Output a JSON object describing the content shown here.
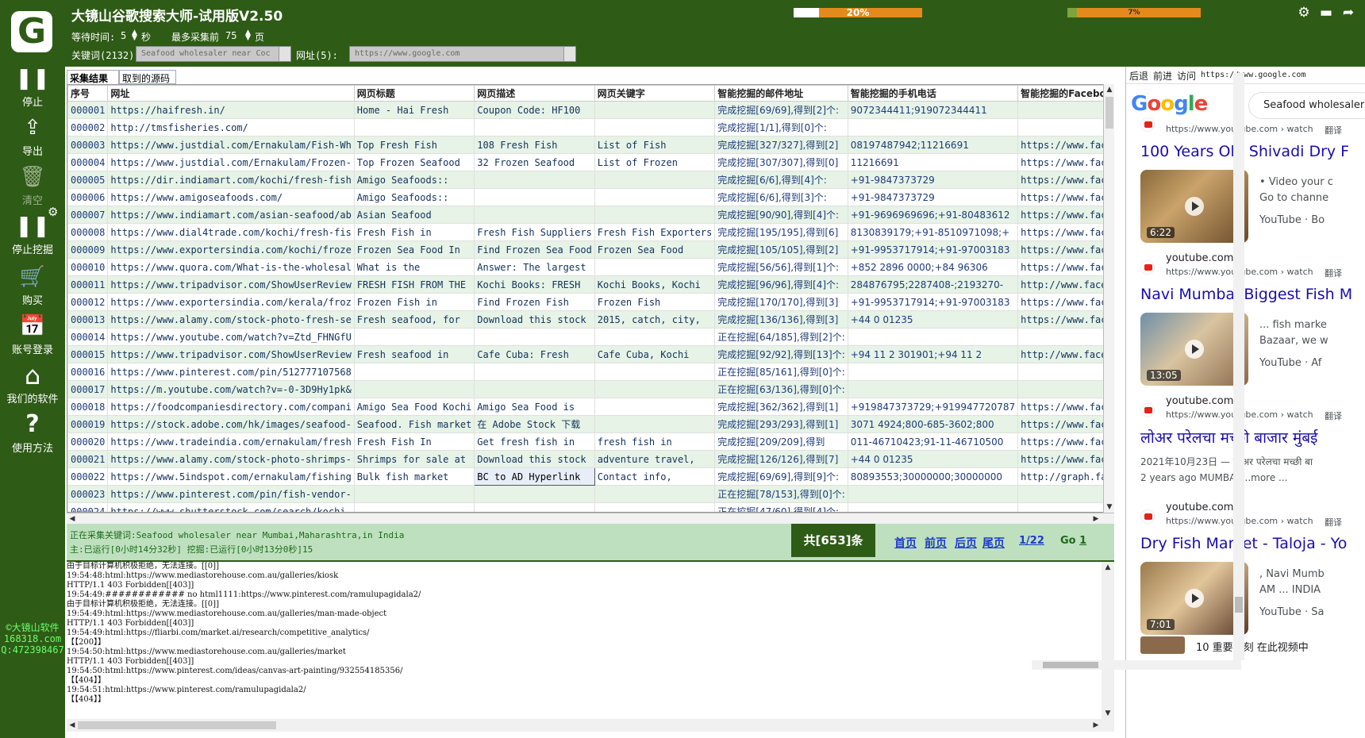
{
  "app": {
    "title": "大镜山谷歌搜索大师-试用版V2.50",
    "logo_letter": "G",
    "wait_label": "等待时间:",
    "wait_value": "5",
    "wait_unit": "秒",
    "max_pages_label": "最多采集前",
    "max_pages_value": "75",
    "max_pages_unit": "页",
    "keyword_label": "关键词(2132):",
    "keyword_value": "Seafood wholesaler near Coc",
    "url_label": "网址(5):",
    "url_value": "https://www.google.com",
    "progress1": {
      "text": "20%",
      "value": 0.2
    },
    "progress2": {
      "text": "7%",
      "value": 0.07
    },
    "accent": "#2e5b16"
  },
  "window_icons": [
    "gear-icon",
    "minimize-icon",
    "share-icon"
  ],
  "sidebar": [
    {
      "name": "stop",
      "label": "停止",
      "icon": "pause-icon",
      "glyph": "❚❚"
    },
    {
      "name": "export",
      "label": "导出",
      "icon": "export-icon",
      "glyph": "⇪"
    },
    {
      "name": "clear",
      "label": "清空",
      "icon": "trash-icon",
      "glyph": "🗑"
    },
    {
      "name": "stop-mining",
      "label": "停止挖掘",
      "icon": "pause-icon",
      "glyph": "❚❚"
    },
    {
      "name": "buy",
      "label": "购买",
      "icon": "cart-icon",
      "glyph": "🛒"
    },
    {
      "name": "account-login",
      "label": "账号登录",
      "icon": "calendar-plus-icon",
      "glyph": "📅"
    },
    {
      "name": "our-software",
      "label": "我们的软件",
      "icon": "home-icon",
      "glyph": "⌂"
    },
    {
      "name": "help",
      "label": "使用方法",
      "icon": "question-icon",
      "glyph": "?"
    }
  ],
  "brand": {
    "line1": "©大镜山软件",
    "line2": "168318.com",
    "line3": "Q:472398467"
  },
  "tabs": [
    "采集结果",
    "取到的源码"
  ],
  "columns": [
    "序号",
    "网址",
    "网页标题",
    "网页描述",
    "网页关键字",
    "智能挖掘的邮件地址",
    "智能挖掘的手机电话",
    "智能挖掘的Facebook"
  ],
  "rows": [
    [
      "000001",
      "https://haifresh.in/",
      "Home - Hai Fresh",
      "Coupon Code: HF100",
      "",
      "完成挖掘[69/69],得到[2]个:",
      "9072344411;919072344411",
      ""
    ],
    [
      "000002",
      "http://tmsfisheries.com/",
      "",
      "",
      "",
      "完成挖掘[1/1],得到[0]个:",
      "",
      ""
    ],
    [
      "000003",
      "https://www.justdial.com/Ernakulam/Fish-Wh",
      "Top Fresh Fish",
      "108 Fresh Fish",
      "List of Fish",
      "完成挖掘[327/327],得到[2]",
      "08197487942;11216691",
      "https://www.face"
    ],
    [
      "000004",
      "https://www.justdial.com/Ernakulam/Frozen-",
      "Top Frozen Seafood",
      "32 Frozen Seafood",
      "List of Frozen",
      "完成挖掘[307/307],得到[0]",
      "11216691",
      "https://www.face"
    ],
    [
      "000005",
      "https://dir.indiamart.com/kochi/fresh-fish",
      "Amigo Seafoods::",
      "",
      "",
      "完成挖掘[6/6],得到[4]个:",
      "+91-9847373729",
      "https://www.face"
    ],
    [
      "000006",
      "https://www.amigoseafoods.com/",
      "Amigo Seafoods::",
      "",
      "",
      "完成挖掘[6/6],得到[3]个:",
      "+91-9847373729",
      "https://www.face"
    ],
    [
      "000007",
      "https://www.indiamart.com/asian-seafood/ab",
      "Asian Seafood",
      "",
      "",
      "完成挖掘[90/90],得到[4]个:",
      "+91-9696969696;+91-80483612",
      "https://www.face"
    ],
    [
      "000008",
      "https://www.dial4trade.com/kochi/fresh-fis",
      "Fresh Fish in",
      "Fresh Fish Suppliers",
      "Fresh Fish Exporters",
      "完成挖掘[195/195],得到[6]",
      "8130839179;+91-8510971098;+",
      "https://www.face"
    ],
    [
      "000009",
      "https://www.exportersindia.com/kochi/froze",
      "Frozen Sea Food In",
      "Find Frozen Sea Food",
      "Frozen Sea Food",
      "完成挖掘[105/105],得到[2]",
      "+91-9953717914;+91-97003183",
      "https://www.face"
    ],
    [
      "000010",
      "https://www.quora.com/What-is-the-wholesal",
      "What is the",
      "Answer: The largest",
      "",
      "完成挖掘[56/56],得到[1]个:",
      "+852 2896 0000;+84 96306",
      "https://www.face"
    ],
    [
      "000011",
      "https://www.tripadvisor.com/ShowUserReview",
      "FRESH FISH FROM THE",
      "Kochi Books: FRESH",
      "Kochi Books, Kochi",
      "完成挖掘[96/96],得到[4]个:",
      "284876795;2287408-;2193270-",
      "http://www.faceb"
    ],
    [
      "000012",
      "https://www.exportersindia.com/kerala/froz",
      "Frozen Fish in",
      "Find Frozen Fish",
      "Frozen Fish",
      "完成挖掘[170/170],得到[3]",
      "+91-9953717914;+91-97003183",
      "https://www.face"
    ],
    [
      "000013",
      "https://www.alamy.com/stock-photo-fresh-se",
      "Fresh seafood, for",
      "Download this stock",
      "2015, catch, city,",
      "完成挖掘[136/136],得到[3]",
      "+44 0 01235",
      "https://www.face"
    ],
    [
      "000014",
      "https://www.youtube.com/watch?v=Ztd_FHNGfU",
      "",
      "",
      "",
      "正在挖掘[64/185],得到[2]个:",
      "",
      ""
    ],
    [
      "000015",
      "https://www.tripadvisor.com/ShowUserReview",
      "Fresh seafood in",
      "Cafe Cuba: Fresh",
      "Cafe Cuba, Kochi",
      "完成挖掘[92/92],得到[13]个:",
      "+94 11 2 301901;+94 11 2",
      "http://www.faceb"
    ],
    [
      "000016",
      "https://www.pinterest.com/pin/512777107568",
      "",
      "",
      "",
      "正在挖掘[85/161],得到[0]个:",
      "",
      ""
    ],
    [
      "000017",
      "https://m.youtube.com/watch?v=-0-3D9Hy1pk&",
      "",
      "",
      "",
      "正在挖掘[63/136],得到[0]个:",
      "",
      ""
    ],
    [
      "000018",
      "https://foodcompaniesdirectory.com/compani",
      "Amigo Sea Food Kochi",
      "Amigo Sea Food is",
      "",
      "完成挖掘[362/362],得到[1]",
      "+919847373729;+919947720787",
      "https://www.face"
    ],
    [
      "000019",
      "https://stock.adobe.com/hk/images/seafood-",
      "Seafood. Fish market",
      "在 Adobe Stock 下载",
      "",
      "完成挖掘[293/293],得到[1]",
      "3071 4924;800-685-3602;800",
      "https://www.face"
    ],
    [
      "000020",
      "https://www.tradeindia.com/ernakulam/fresh",
      "Fresh Fish In",
      "Get fresh fish in",
      "fresh fish in",
      "完成挖掘[209/209],得到",
      "011-46710423;91-11-46710500",
      "https://www.face"
    ],
    [
      "000021",
      "https://www.alamy.com/stock-photo-shrimps-",
      "Shrimps for sale at",
      "Download this stock",
      "adventure travel,",
      "完成挖掘[126/126],得到[7]",
      "+44 0 01235",
      "https://www.face"
    ],
    [
      "000022",
      "https://www.5indspot.com/ernakulam/fishing",
      "Bulk fish market",
      "BC to AD Hyperlink",
      "Contact info,",
      "完成挖掘[69/69],得到[9]个:",
      "80893553;30000000;30000000",
      "http://graph.fac"
    ],
    [
      "000023",
      "https://www.pinterest.com/pin/fish-vendor-",
      "",
      "",
      "",
      "正在挖掘[78/153],得到[0]个:",
      "",
      ""
    ],
    [
      "000024",
      "https://www.shutterstock.com/search/kochi-",
      "",
      "",
      "",
      "正在挖掘[47/60],得到[4]个:",
      "",
      ""
    ]
  ],
  "status": {
    "line1": "正在采集关键词:Seafood wholesaler near Mumbai,Maharashtra,in India",
    "line2": "主:已运行[0小时14分32秒] 挖掘:已运行[0小时13分0秒]15",
    "count": "共[653]条",
    "first": "首页",
    "prev": "前页",
    "next": "后页",
    "last": "尾页",
    "page": "1/22",
    "go_label": "Go",
    "go_value": "1"
  },
  "log_lines": [
    "由于目标计算机积极拒绝，无法连接。[[0]]",
    "19:54:48:html:https://www.mediastorehouse.com.au/galleries/kiosk",
    "HTTP/1.1 403 Forbidden[[403]]",
    "19:54:49:############ no html1111:https://www.pinterest.com/ramulupagidala2/",
    "由于目标计算机积极拒绝，无法连接。[[0]]",
    "19:54:49:html:https://www.mediastorehouse.com.au/galleries/man-made-object",
    "HTTP/1.1 403 Forbidden[[403]]",
    "19:54:49:html:https://fliarbi.com/market.ai/research/competitive_analytics/",
    "【【200】】",
    "19:54:50:html:https://www.mediastorehouse.com.au/galleries/market",
    "HTTP/1.1 403 Forbidden[[403]]",
    "19:54:50:html:https://www.pinterest.com/ideas/canvas-art-painting/932554185356/",
    "【【404】】",
    "19:54:51:html:https://www.pinterest.com/ramulupagidala2/",
    "【【404】】"
  ],
  "browser": {
    "back": "后退",
    "forward": "前进",
    "visit": "访问",
    "url": "https://www.google.com",
    "google_logo": "Google",
    "search_text": "Seafood wholesaler",
    "results": [
      {
        "domain": "youtube.com",
        "url": "https://www.youtube.com › watch",
        "translate": "翻译",
        "title": "100 Years Old Shivadi Dry F",
        "duration": "6:22",
        "snip1": "• Video your c",
        "snip2": "Go to channe",
        "snip3": "YouTube · Bo"
      },
      {
        "domain": "youtube.com",
        "url": "https://www.youtube.com › watch",
        "translate": "翻译",
        "title": "Navi Mumbai Biggest Fish M",
        "duration": "13:05",
        "snip1": "... fish marke",
        "snip2": "Bazaar, we w",
        "snip3": "YouTube · Af"
      },
      {
        "domain": "youtube.com",
        "url": "https://www.youtube.com › watch",
        "translate": "翻译",
        "title": "लोअर परेलचा मच्छी बाजार मुंबई",
        "date": "2021年10月23日 — लोअर परेलचा मच्छी बा",
        "snip": "2 years ago MUMBAI ...more ..."
      },
      {
        "domain": "youtube.com",
        "url": "https://www.youtube.com › watch",
        "translate": "翻译",
        "title": "Dry Fish Market - Taloja - Yo",
        "duration": "7:01",
        "snip1": ", Navi Mumb",
        "snip2": "AM ... INDIA",
        "snip3": "YouTube · Sa"
      }
    ],
    "moments": "10 重要时刻 在此视频中"
  }
}
